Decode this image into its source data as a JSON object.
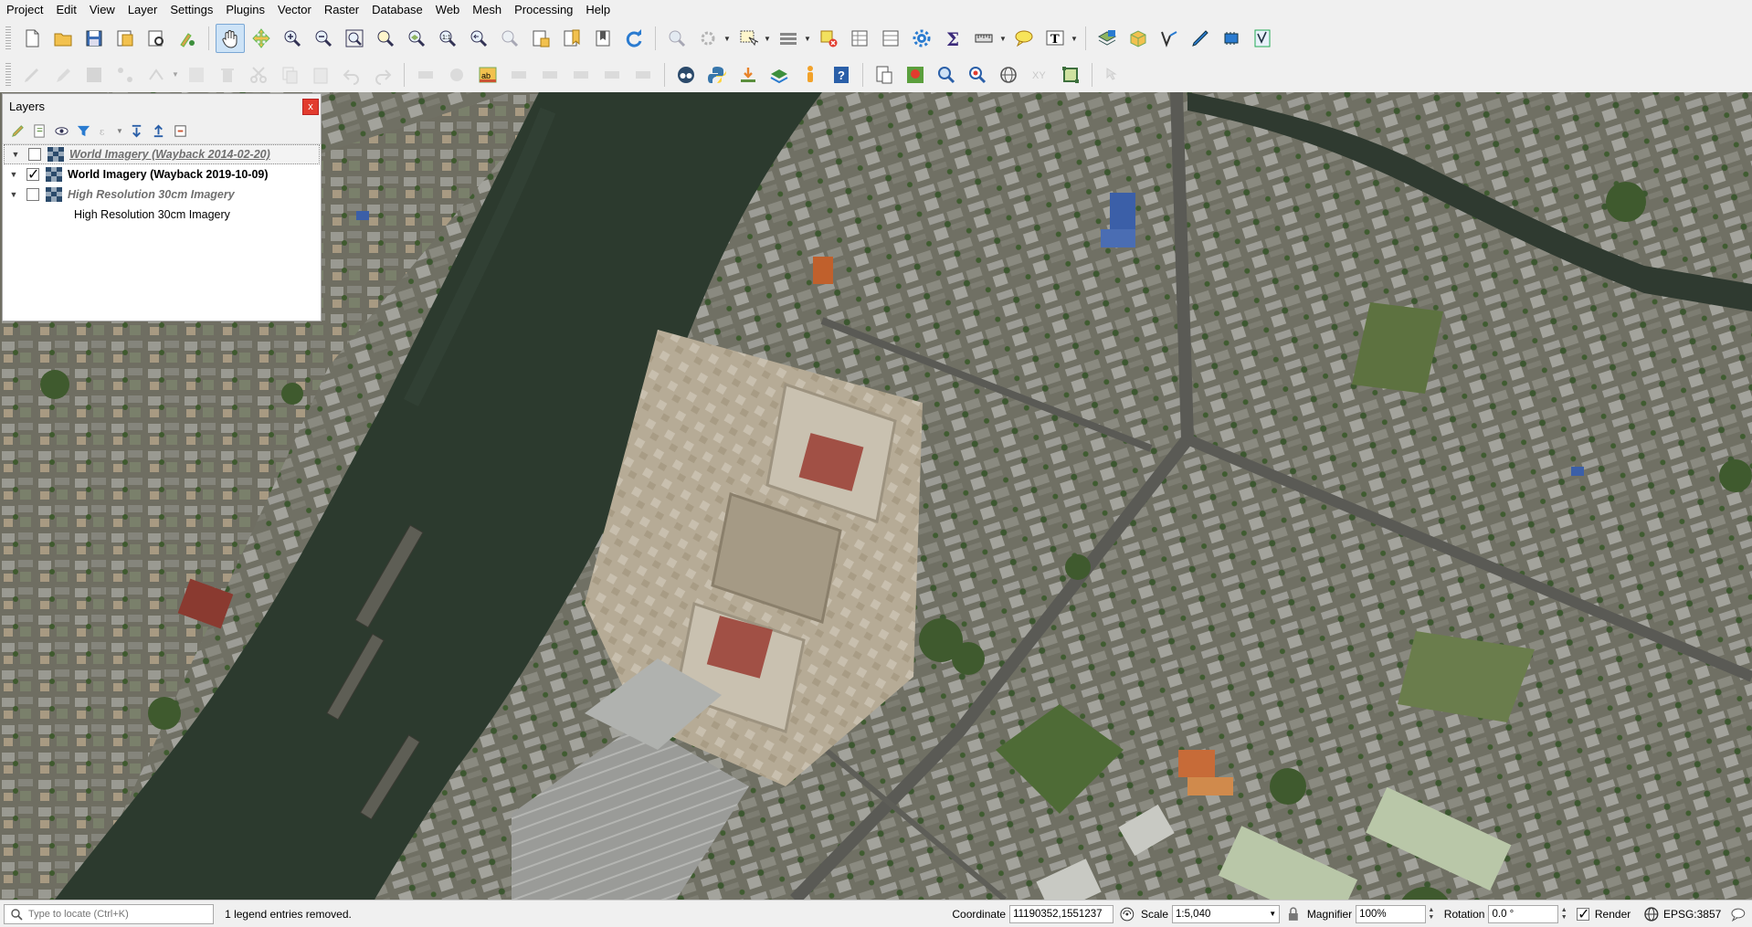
{
  "menu": [
    "Project",
    "Edit",
    "View",
    "Layer",
    "Settings",
    "Plugins",
    "Vector",
    "Raster",
    "Database",
    "Web",
    "Mesh",
    "Processing",
    "Help"
  ],
  "layers_panel": {
    "title": "Layers",
    "close_glyph": "x",
    "layers": [
      {
        "name": "World Imagery (Wayback 2014-02-20)",
        "checked": false,
        "style": "italic-underline"
      },
      {
        "name": "World Imagery (Wayback 2019-10-09)",
        "checked": true,
        "style": "bold"
      },
      {
        "name": "High Resolution 30cm Imagery",
        "checked": false,
        "style": "italic"
      }
    ],
    "legend_child": "High Resolution 30cm Imagery"
  },
  "statusbar": {
    "locator_placeholder": "Type to locate (Ctrl+K)",
    "message": "1 legend entries removed.",
    "coordinate_label": "Coordinate",
    "coordinate_value": "11190352,1551237",
    "scale_label": "Scale",
    "scale_value": "1:5,040",
    "magnifier_label": "Magnifier",
    "magnifier_value": "100%",
    "rotation_label": "Rotation",
    "rotation_value": "0.0 °",
    "render_label": "Render",
    "render_checked": true,
    "crs": "EPSG:3857"
  },
  "colors": {
    "ui_bg": "#f0f0f0",
    "river": "#2c3a2e",
    "vegetation": "#3f5a2e",
    "roof_red": "#9a3c32",
    "roof_blue": "#3b5fa8"
  }
}
